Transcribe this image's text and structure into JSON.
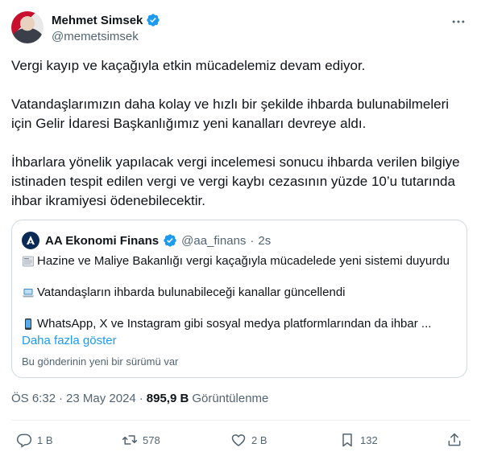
{
  "author": {
    "name": "Mehmet Simsek",
    "handle": "@memetsimsek",
    "verified_icon": "verified-badge-icon",
    "more_icon": "more-icon"
  },
  "tweet": {
    "paragraphs": [
      "Vergi kayıp ve kaçağıyla etkin mücadelemiz devam ediyor.",
      "Vatandaşlarımızın daha kolay ve hızlı bir şekilde ihbarda bulunabilmeleri için Gelir İdaresi Başkanlığımız yeni kanalları devreye aldı.",
      "İhbarlara yönelik yapılacak vergi incelemesi sonucu ihbarda verilen bilgiye istinaden tespit edilen vergi ve vergi kaybı cezasının yüzde 10’u tutarında ihbar ikramiyesi ödenebilecektir."
    ]
  },
  "quote": {
    "name": "AA Ekonomi Finans",
    "handle": "@aa_finans",
    "separator": "·",
    "time": "2s",
    "lines": [
      {
        "icon": "newspaper-icon",
        "text": "Hazine ve Maliye Bakanlığı vergi kaçağıyla mücadelede yeni sistemi duyurdu"
      },
      {
        "icon": "laptop-icon",
        "text": "Vatandaşların ihbarda bulunabileceği kanallar güncellendi"
      },
      {
        "icon": "mobile-phone-icon",
        "text": "WhatsApp, X ve Instagram gibi sosyal medya platformlarından da ihbar ..."
      }
    ],
    "show_more": "Daha fazla göster",
    "note": "Bu gönderinin yeni bir sürümü var"
  },
  "meta": {
    "time": "ÖS 6:32",
    "date": "23 May 2024",
    "separator": "·",
    "views_count": "895,9 B",
    "views_label": "Görüntülenme"
  },
  "actions": {
    "replies": "1 B",
    "retweets": "578",
    "likes": "2 B",
    "bookmarks": "132"
  },
  "colors": {
    "accent": "#1d9bf0",
    "text_primary": "#0f1419",
    "text_secondary": "#536471",
    "border": "#cfd9de"
  }
}
